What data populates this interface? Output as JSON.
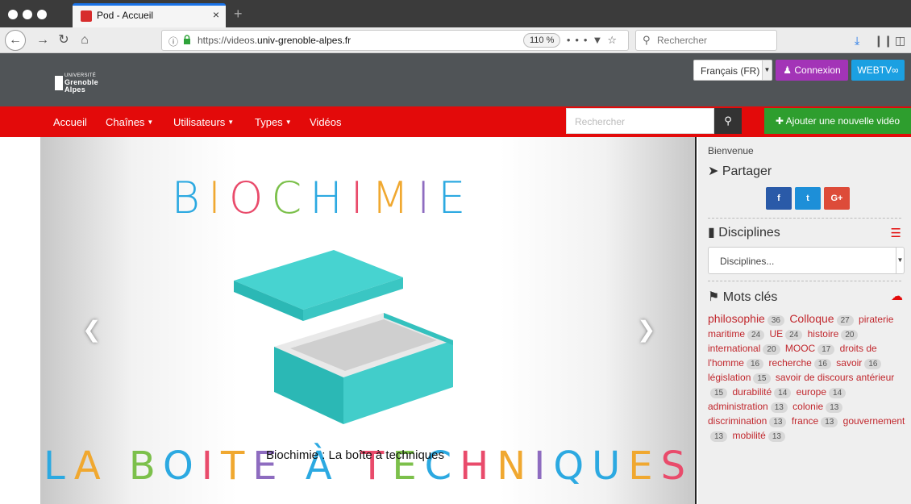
{
  "browser": {
    "tab_title": "Pod - Accueil",
    "tab_close": "×",
    "new_tab": "+",
    "url_prefix": "https://videos.",
    "url_host": "univ-grenoble-alpes.fr",
    "zoom": "110 %",
    "url_menu": "•••",
    "search_placeholder": "Rechercher"
  },
  "header": {
    "logo_line1": "UNIVERSITÉ",
    "logo_line2": "Grenoble",
    "logo_line3": "Alpes",
    "language": "Français (FR)",
    "login_label": "Connexion",
    "webtv_label": "WEBTV"
  },
  "nav": {
    "items": [
      {
        "label": "Accueil",
        "dropdown": false
      },
      {
        "label": "Chaînes",
        "dropdown": true
      },
      {
        "label": "Utilisateurs",
        "dropdown": true
      },
      {
        "label": "Types",
        "dropdown": true
      },
      {
        "label": "Vidéos",
        "dropdown": false
      }
    ],
    "search_placeholder": "Rechercher",
    "add_video_label": "Ajouter une nouvelle vidéo"
  },
  "slide": {
    "headline": "BIOCHIMIE",
    "bottom_text": "LA BOITE À TECHNIQUES",
    "caption": "Biochimie : La boîte à techniques"
  },
  "sidebar": {
    "welcome": "Bienvenue",
    "share_title": "Partager",
    "share_buttons": [
      "f",
      "t",
      "G+"
    ],
    "disciplines_title": "Disciplines",
    "disciplines_select": "Disciplines...",
    "tags_title": "Mots clés",
    "tags": [
      {
        "name": "philosophie",
        "count": "36",
        "size": "lg"
      },
      {
        "name": "Colloque",
        "count": "27",
        "size": "lg"
      },
      {
        "name": "piraterie maritime",
        "count": "24"
      },
      {
        "name": "UE",
        "count": "24"
      },
      {
        "name": "histoire",
        "count": "20"
      },
      {
        "name": "international",
        "count": "20"
      },
      {
        "name": "MOOC",
        "count": "17"
      },
      {
        "name": "droits de l'homme",
        "count": "16"
      },
      {
        "name": "recherche",
        "count": "16"
      },
      {
        "name": "savoir",
        "count": "16"
      },
      {
        "name": "législation",
        "count": "15"
      },
      {
        "name": "savoir de discours antérieur",
        "count": "15"
      },
      {
        "name": "durabilité",
        "count": "14"
      },
      {
        "name": "europe",
        "count": "14"
      },
      {
        "name": "administration",
        "count": "13"
      },
      {
        "name": "colonie",
        "count": "13"
      },
      {
        "name": "discrimination",
        "count": "13"
      },
      {
        "name": "france",
        "count": "13"
      },
      {
        "name": "gouvernement",
        "count": "13"
      },
      {
        "name": "mobilité",
        "count": "13"
      }
    ]
  },
  "colors": {
    "nav_red": "#e30a0a",
    "header_gray": "#505457",
    "login_purple": "#a334b7",
    "webtv_blue": "#1ba0e2",
    "add_green": "#2e9e2e",
    "tag_red": "#c1272d",
    "facebook": "#2a5aa8",
    "twitter": "#1d8fd8",
    "googleplus": "#dd4b39"
  }
}
